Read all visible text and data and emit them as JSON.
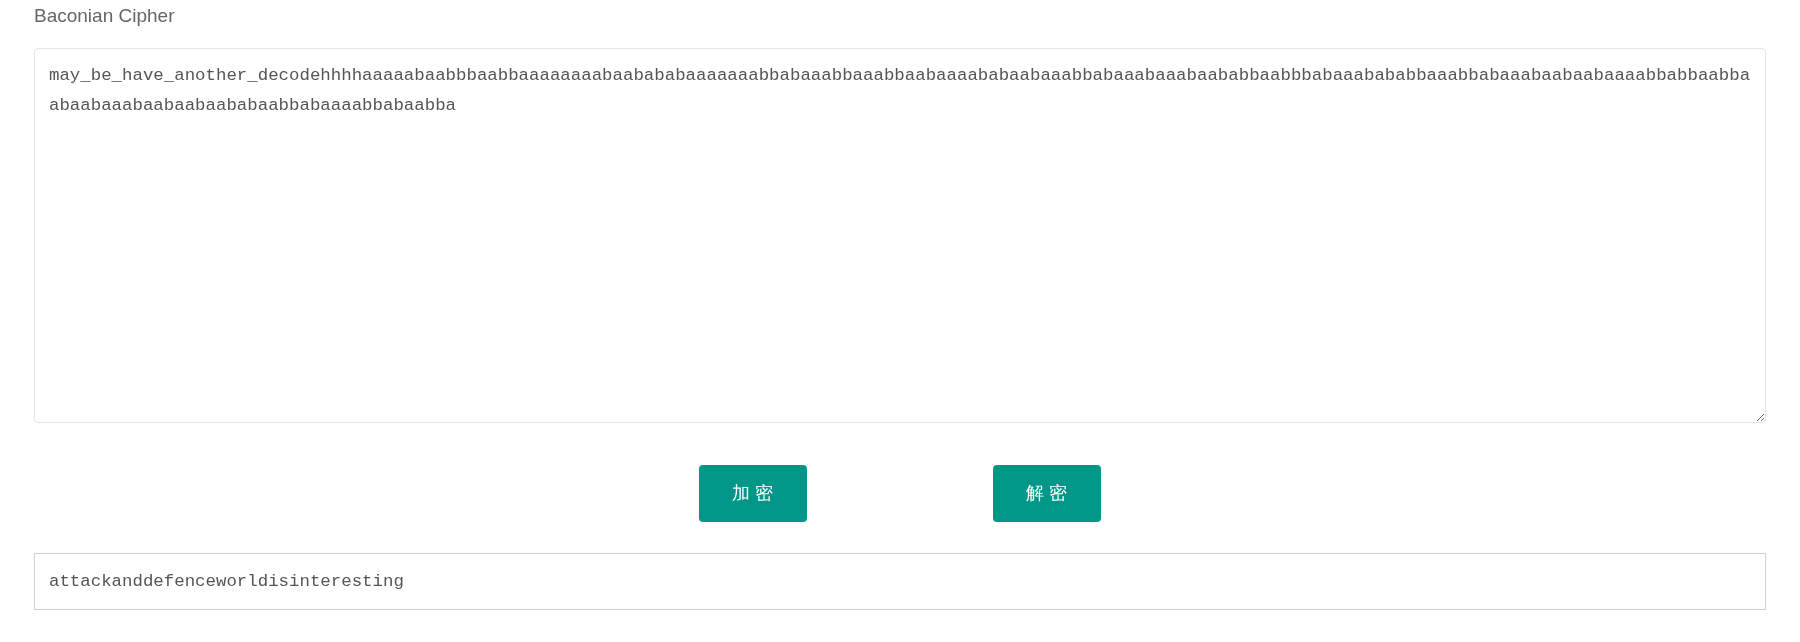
{
  "title": "Baconian Cipher",
  "input": {
    "value": "may_be_have_another_decodehhhhaaaaabaabbbaabbaaaaaaaabaabababaaaaaaabbabaaabbaaabbaabaaaababaabaaabbabaaabaaabaababbaabbbabaaabababbaaabbabaaabaabaabaaaabbabbaabbaabaabaaabaabaabaababaabbabaaaabbabaabba"
  },
  "buttons": [
    "加 密",
    "解 密"
  ],
  "output": {
    "value": "attackanddefenceworldisinteresting"
  }
}
